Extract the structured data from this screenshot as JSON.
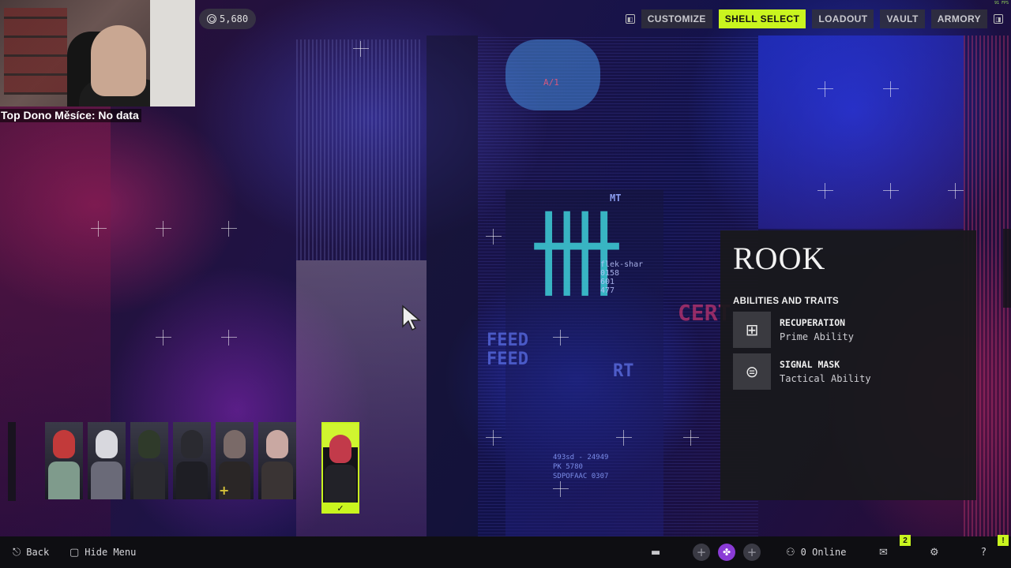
{
  "stream_overlay": {
    "donor_text": "Top Dono Měsíce: No data",
    "fps_text": "91 FPS"
  },
  "currency": {
    "icon": "currency-coin-icon",
    "amount": "5,680"
  },
  "topnav": {
    "left_key_icon": "keybind-q-icon",
    "right_key_icon": "keybind-e-icon",
    "items": [
      {
        "label": "CUSTOMIZE",
        "active": false
      },
      {
        "label": "SHELL SELECT",
        "active": true
      },
      {
        "label": "LOADOUT",
        "active": false
      },
      {
        "label": "VAULT",
        "active": false
      },
      {
        "label": "ARMORY",
        "active": false
      }
    ],
    "active_color": "#c9f51f"
  },
  "scene_text": {
    "tag_top": "A/1",
    "brand_short": "MT",
    "sticker_lines": [
      "flek-shar",
      "0158",
      "601",
      "477"
    ],
    "feed_1": "FEED",
    "feed_2": "FEED",
    "cert": "CERT",
    "rt": "RT",
    "serial_lines": [
      "493sd - 24949",
      "PK 5780",
      "SDPOFAAC 0307"
    ]
  },
  "shells": [
    {
      "name": "shell-portrait-1",
      "face": "#c23a3a",
      "torso": "#7f9b8c"
    },
    {
      "name": "shell-portrait-2",
      "face": "#d8d8de",
      "torso": "#6a6a78"
    },
    {
      "name": "shell-portrait-3",
      "face": "#2f3a2a",
      "torso": "#2b2b30"
    },
    {
      "name": "shell-portrait-4",
      "face": "#2a2a30",
      "torso": "#1e1e24"
    },
    {
      "name": "shell-portrait-5",
      "face": "#7a6a68",
      "torso": "#2a2626",
      "plus": "+"
    },
    {
      "name": "shell-portrait-6",
      "face": "#c9a8a2",
      "torso": "#3a3434"
    }
  ],
  "selected_shell": {
    "check": "✓"
  },
  "info_panel": {
    "shell_name": "ROOK",
    "section_title": "ABILITIES AND TRAITS",
    "abilities": [
      {
        "name": "RECUPERATION",
        "type": "Prime Ability",
        "icon": "recuperation-icon",
        "glyph": "⊞"
      },
      {
        "name": "SIGNAL MASK",
        "type": "Tactical Ability",
        "icon": "signal-mask-icon",
        "glyph": "⊜"
      }
    ]
  },
  "bottom_bar": {
    "back_label": "Back",
    "hide_menu_label": "Hide Menu",
    "online_label": "0 Online",
    "chat_icon": "chat-icon",
    "mail_icon": "mail-icon",
    "settings_icon": "gear-icon",
    "help_icon": "help-icon",
    "mail_badge": "2",
    "alert_badge": "!",
    "squad_add": "+"
  }
}
